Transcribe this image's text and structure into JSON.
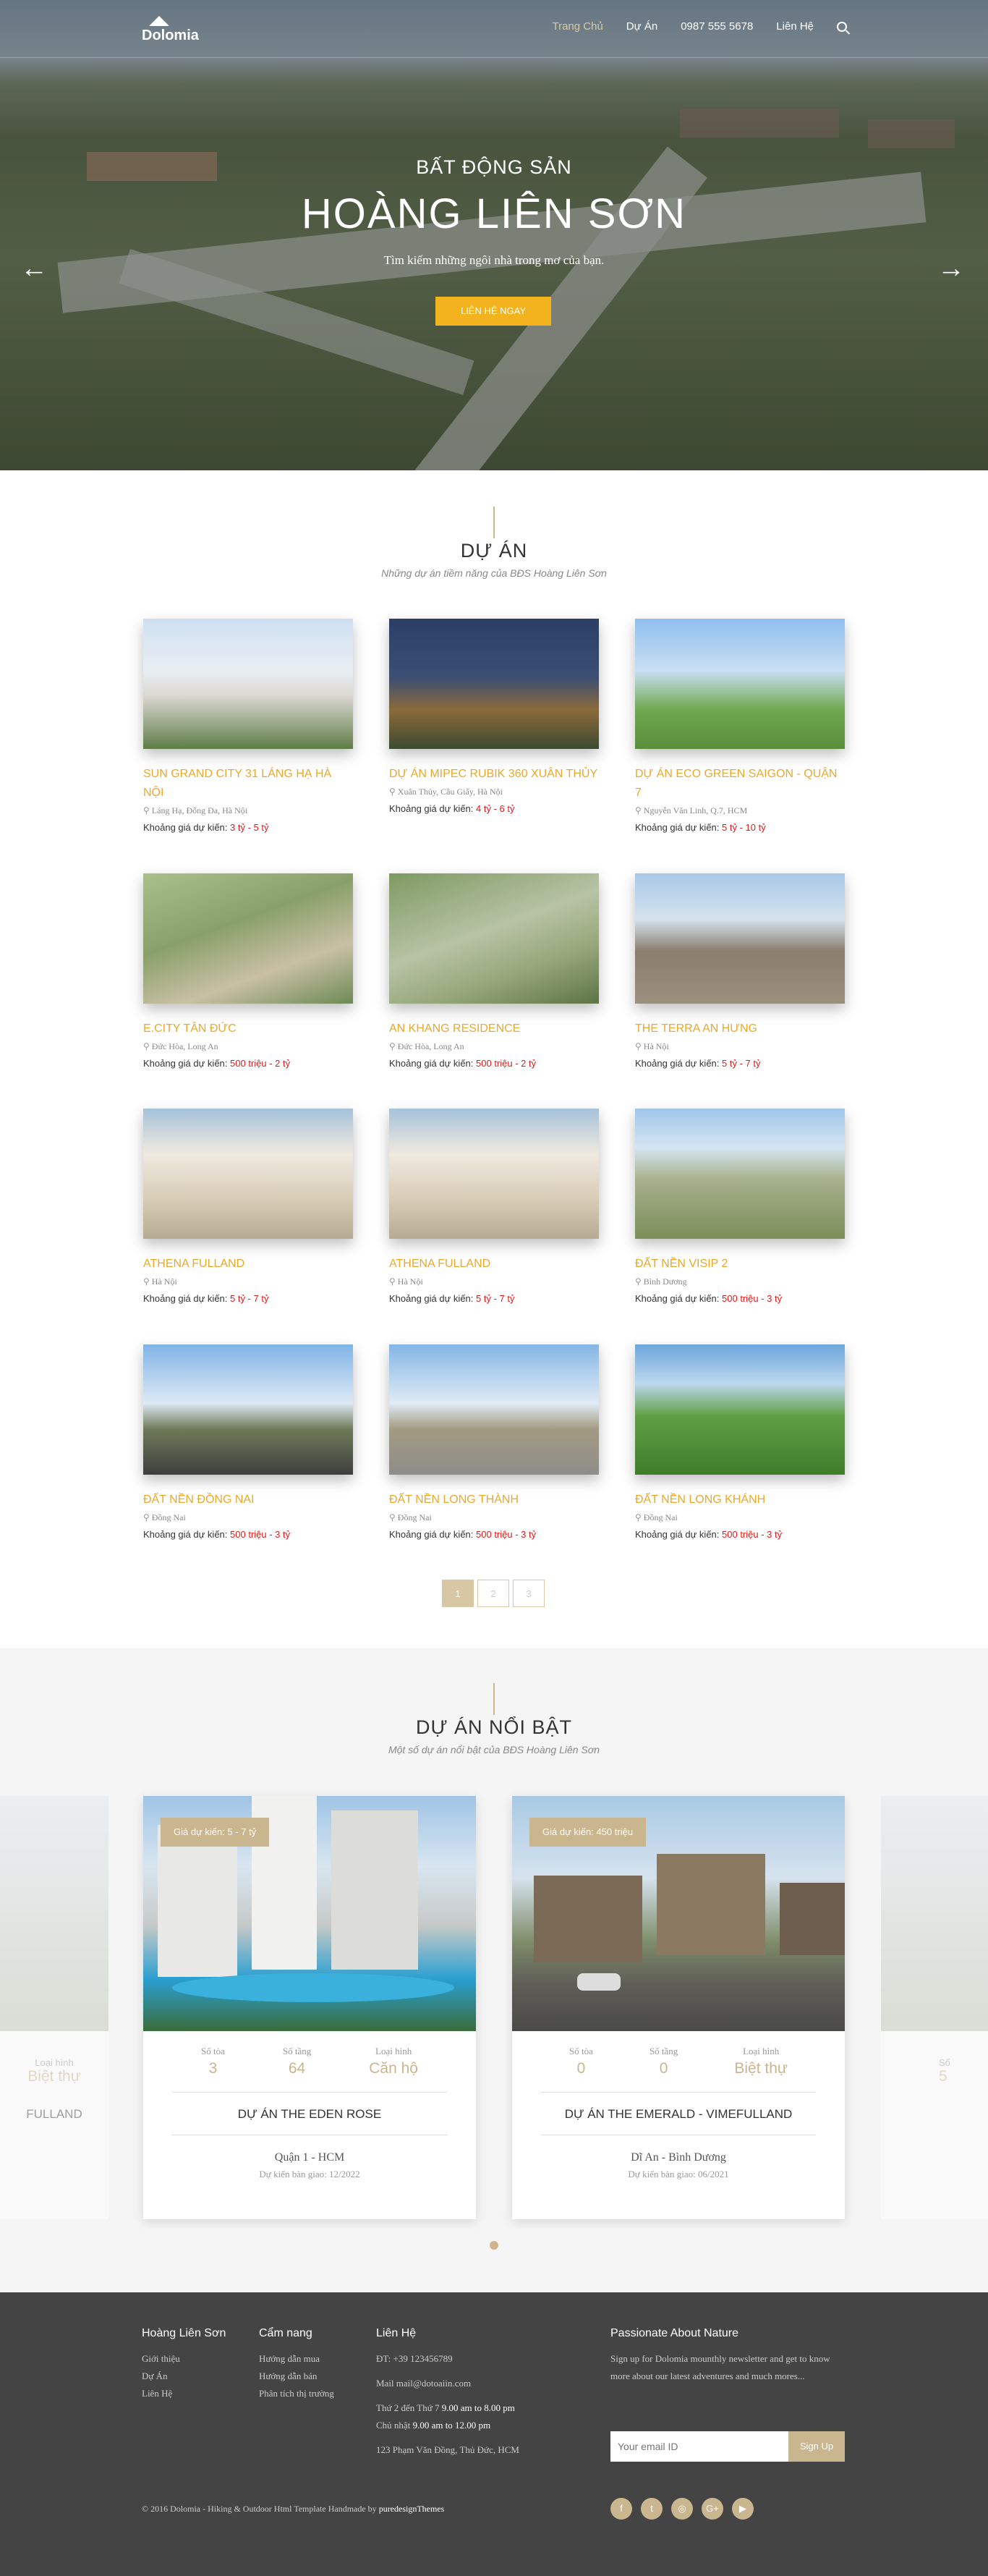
{
  "nav": {
    "logo": "Dolomia",
    "items": [
      "Trang Chủ",
      "Dự Án",
      "0987 555 5678",
      "Liên Hệ"
    ]
  },
  "hero": {
    "subtitle": "BẤT ĐỘNG SẢN",
    "title": "HOÀNG LIÊN SƠN",
    "desc": "Tìm kiếm những ngôi nhà trong mơ của bạn.",
    "cta": "LIÊN HỆ NGAY",
    "prev": "←",
    "next": "→"
  },
  "projects": {
    "title": "DỰ ÁN",
    "subtitle": "Những dự án tiềm năng của BĐS Hoàng Liên Sơn",
    "price_label": "Khoảng giá dự kiến: ",
    "items": [
      {
        "title": "SUN GRAND CITY 31 LÁNG HẠ HÀ NỘI",
        "loc": "Láng Hạ, Đống Đa, Hà Nội",
        "price": "3 tỷ - 5 tỷ"
      },
      {
        "title": "DỰ ÁN MIPEC RUBIK 360 XUÂN THỦY",
        "loc": "Xuân Thủy, Cầu Giấy, Hà Nội",
        "price": "4 tỷ - 6 tỷ"
      },
      {
        "title": "DỰ ÁN ECO GREEN SAIGON - QUẬN 7",
        "loc": "Nguyễn Văn Linh, Q.7, HCM",
        "price": "5 tỷ - 10 tỷ"
      },
      {
        "title": "E.CITY TÂN ĐỨC",
        "loc": "Đức Hòa, Long An",
        "price": "500 triệu - 2 tỷ"
      },
      {
        "title": "AN KHANG RESIDENCE",
        "loc": "Đức Hòa, Long An",
        "price": "500 triệu - 2 tỷ"
      },
      {
        "title": "THE TERRA AN HƯNG",
        "loc": "Hà Nội",
        "price": "5 tỷ - 7 tỷ"
      },
      {
        "title": "ATHENA FULLAND",
        "loc": "Hà Nội",
        "price": "5 tỷ - 7 tỷ"
      },
      {
        "title": "ATHENA FULLAND",
        "loc": "Hà Nội",
        "price": "5 tỷ - 7 tỷ"
      },
      {
        "title": "ĐẤT NỀN VISIP 2",
        "loc": "Bình Dương",
        "price": "500 triệu - 3 tỷ"
      },
      {
        "title": "ĐẤT NỀN ĐỒNG NAI",
        "loc": "Đồng Nai",
        "price": "500 triệu - 3 tỷ"
      },
      {
        "title": "ĐẤT NỀN LONG THÀNH",
        "loc": "Đồng Nai",
        "price": "500 triệu - 3 tỷ"
      },
      {
        "title": "ĐẤT NỀN LONG KHÁNH",
        "loc": "Đồng Nai",
        "price": "500 triệu - 3 tỷ"
      }
    ],
    "pages": [
      "1",
      "2",
      "3"
    ]
  },
  "featured": {
    "title": "DỰ ÁN NỔI BẬT",
    "subtitle": "Một số dự án nổi bật của BĐS Hoàng Liên Sơn",
    "labels": {
      "towers": "Số tòa",
      "floors": "Số tầng",
      "type": "Loại hình"
    },
    "items": [
      {
        "badge": "Giá dự kiến: 5 - 7 tỷ",
        "towers": "3",
        "floors": "64",
        "type": "Căn hộ",
        "name": "DỰ ÁN THE EDEN ROSE",
        "loc": "Quận 1 - HCM",
        "date": "Dự kiến bàn giao: 12/2022"
      },
      {
        "badge": "Giá dự kiến: 450 triệu",
        "towers": "0",
        "floors": "0",
        "type": "Biệt thự",
        "name": "DỰ ÁN THE EMERALD - VIMEFULLAND",
        "loc": "Dĩ An - Bình Dương",
        "date": "Dự kiến bàn giao: 06/2021"
      }
    ],
    "ghost_left": {
      "type_label": "Loại hình",
      "type": "Biệt thự",
      "name": "FULLAND"
    },
    "ghost_right": {
      "towers_label": "Số",
      "towers": "5"
    }
  },
  "footer": {
    "col1": {
      "title": "Hoàng Liên Sơn",
      "links": [
        "Giới thiệu",
        "Dự Án",
        "Liên Hệ"
      ]
    },
    "col2": {
      "title": "Cẩm nang",
      "links": [
        "Hướng dẫn mua",
        "Hướng dẫn bán",
        "Phân tích thị trường"
      ]
    },
    "col3": {
      "title": "Liên Hệ",
      "phone": "ĐT: +39 123456789",
      "mail": "Mail mail@dotoaiin.com",
      "hours1_label": "Thứ 2 đến Thứ 7 ",
      "hours1": "9.00 am to 8.00 pm",
      "hours2_label": "Chủ nhật ",
      "hours2": "9.00 am to 12.00 pm",
      "address": "123 Phạm Văn Đồng, Thủ Đức, HCM"
    },
    "col4": {
      "title": "Passionate About Nature",
      "text": "Sign up for Dolomia mounthly newsletter and get to know more about our latest adventures and much mores...",
      "placeholder": "Your email ID",
      "button": "Sign Up"
    },
    "copyright": "© 2016 Dolomia - Hiking & Outdoor Html Template Handmade by ",
    "copyright_link": "puredesignThemes",
    "socials": [
      "f",
      "t",
      "◎",
      "G+",
      "▶"
    ]
  }
}
